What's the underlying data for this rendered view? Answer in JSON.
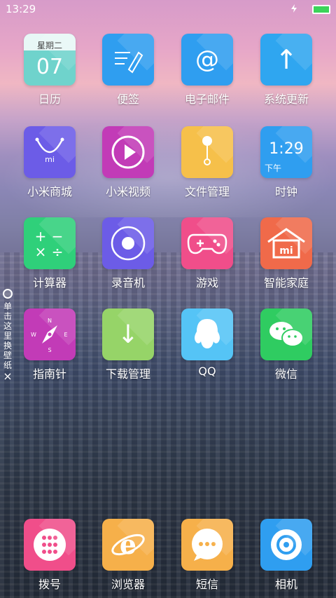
{
  "status_bar": {
    "time": "13:29"
  },
  "apps": {
    "calendar": {
      "label": "日历",
      "weekday": "星期二",
      "date": "07"
    },
    "notes": {
      "label": "便签"
    },
    "email": {
      "label": "电子邮件",
      "glyph": "@"
    },
    "updater": {
      "label": "系统更新",
      "glyph": "↑"
    },
    "mi_store": {
      "label": "小米商城",
      "glyph": "mi"
    },
    "mi_video": {
      "label": "小米视频"
    },
    "file_manager": {
      "label": "文件管理"
    },
    "clock": {
      "label": "时钟",
      "time": "1:29",
      "ampm": "下午"
    },
    "calculator": {
      "label": "计算器",
      "glyph": "+ −\n× ÷"
    },
    "recorder": {
      "label": "录音机"
    },
    "games": {
      "label": "游戏"
    },
    "smart_home": {
      "label": "智能家庭",
      "glyph": "mi"
    },
    "compass": {
      "label": "指南针"
    },
    "download_manager": {
      "label": "下载管理",
      "glyph": "↓"
    },
    "qq": {
      "label": "QQ"
    },
    "wechat": {
      "label": "微信"
    }
  },
  "dock": {
    "dialer": {
      "label": "拨号"
    },
    "browser": {
      "label": "浏览器",
      "glyph": "e"
    },
    "sms": {
      "label": "短信",
      "glyph": "···"
    },
    "camera": {
      "label": "相机"
    }
  },
  "wallpaper_hint": {
    "text": "单击这里换壁纸",
    "close": "×"
  },
  "colors": {
    "calendar": "#6fd3cc",
    "notes": "#2f9ef0",
    "email": "#2f9ef0",
    "updater": "#2fa6f0",
    "mi_store": "#6c5ce7",
    "mi_video": "#c23bb7",
    "file_manager": "#f6c04a",
    "clock": "#2f9ef0",
    "calculator": "#2fd07a",
    "recorder": "#6c5ce7",
    "games": "#f04e8a",
    "smart_home": "#f06a4a",
    "compass": "#c23bb7",
    "download_manager": "#96d468",
    "qq": "#55c4f6",
    "wechat": "#2fcc61",
    "dialer": "#f04e8a",
    "browser": "#f6b04a",
    "sms": "#f6b04a",
    "camera": "#2f9ef0"
  }
}
